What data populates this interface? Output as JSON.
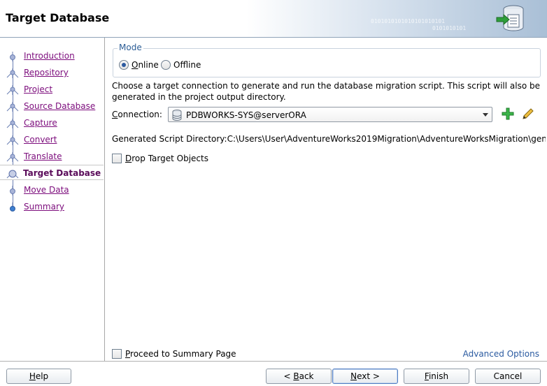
{
  "header": {
    "title": "Target Database",
    "binary_1": "0101010101010101010101",
    "binary_2": "0101010101"
  },
  "nav": {
    "items": [
      {
        "label": "Introduction",
        "state": "done"
      },
      {
        "label": "Repository",
        "state": "done"
      },
      {
        "label": "Project",
        "state": "done"
      },
      {
        "label": "Source Database",
        "state": "done"
      },
      {
        "label": "Capture",
        "state": "done"
      },
      {
        "label": "Convert",
        "state": "done"
      },
      {
        "label": "Translate",
        "state": "done"
      },
      {
        "label": "Target Database",
        "state": "current"
      },
      {
        "label": "Move Data",
        "state": "pending"
      },
      {
        "label": "Summary",
        "state": "pending"
      }
    ]
  },
  "mode": {
    "legend": "Mode",
    "online_label_mnemonic": "O",
    "online_label_rest": "nline",
    "offline_label_pre": "Off",
    "offline_label_mnemonic": "l",
    "offline_label_rest": "ine",
    "selected": "Online"
  },
  "description": "Choose a target connection to generate and run the database migration script.  This script will also be generated in the project output directory.",
  "connection": {
    "label_mnemonic": "C",
    "label_rest": "onnection:",
    "value": "PDBWORKS-SYS@serverORA"
  },
  "script_directory": "Generated Script Directory:C:\\Users\\User\\AdventureWorks2019Migration\\AdventureWorksMigration\\gen...",
  "drop_target": {
    "label_mnemonic": "D",
    "label_rest": "rop Target Objects",
    "checked": false
  },
  "proceed": {
    "label_mnemonic": "P",
    "label_rest": "roceed to Summary Page",
    "checked": false
  },
  "advanced_options": "Advanced Options",
  "buttons": {
    "help_mnemonic": "H",
    "help_rest": "elp",
    "back_pre": "< ",
    "back_mnemonic": "B",
    "back_rest": "ack",
    "next_mnemonic": "N",
    "next_rest": "ext >",
    "finish_mnemonic": "F",
    "finish_rest": "inish",
    "cancel": "Cancel"
  },
  "colors": {
    "link": "#7c0c7c",
    "accent": "#2a5aa0",
    "node": "#6b7fb3"
  }
}
